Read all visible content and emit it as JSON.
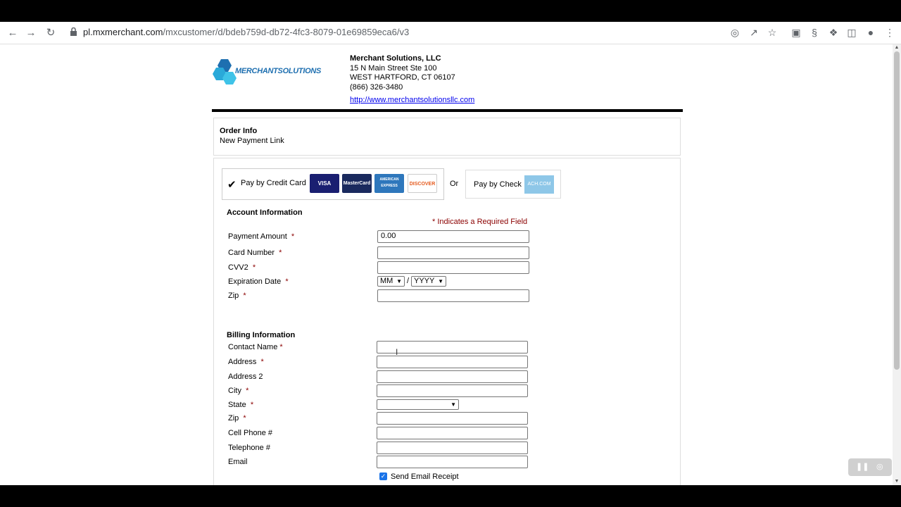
{
  "browser": {
    "url_host": "pl.mxmerchant.com",
    "url_path": "/mxcustomer/d/bdeb759d-db72-4fc3-8079-01e69859eca6/v3"
  },
  "merchant": {
    "logo_text": "MERCHANTSOLUTIONS",
    "name": "Merchant Solutions, LLC",
    "address1": "15 N Main Street Ste 100",
    "address2": "WEST HARTFORD, CT 06107",
    "phone": "(866) 326-3480",
    "website": "http://www.merchantsolutionsllc.com"
  },
  "order": {
    "title": "Order Info",
    "subtitle": "New Payment Link"
  },
  "payment_tabs": {
    "credit_card_label": "Pay by Credit Card",
    "cards": [
      {
        "name": "VISA",
        "bg": "#1a1f71",
        "fg": "#ffffff"
      },
      {
        "name": "MasterCard",
        "bg": "#1a2a5e",
        "fg": "#ffffff"
      },
      {
        "name": "AMERICAN EXPRESS",
        "bg": "#2e77bc",
        "fg": "#ffffff"
      },
      {
        "name": "DISCOVER",
        "bg": "#ffffff",
        "fg": "#e55c20"
      }
    ],
    "or_label": "Or",
    "check_label": "Pay by Check",
    "ach_label": "ACH.COM"
  },
  "account": {
    "heading": "Account Information",
    "required_note": "* Indicates a Required Field",
    "payment_amount_label": "Payment Amount",
    "payment_amount_value": "0.00",
    "card_number_label": "Card Number",
    "cvv_label": "CVV2",
    "exp_label": "Expiration Date",
    "exp_month": "MM",
    "exp_year": "YYYY",
    "exp_sep": "/",
    "zip_label": "Zip"
  },
  "billing": {
    "heading": "Billing Information",
    "contact_label": "Contact Name",
    "address_label": "Address",
    "address2_label": "Address 2",
    "city_label": "City",
    "state_label": "State",
    "zip_label": "Zip",
    "cell_label": "Cell Phone #",
    "tel_label": "Telephone #",
    "email_label": "Email",
    "send_receipt_label": "Send Email Receipt"
  },
  "required_mark": "*"
}
